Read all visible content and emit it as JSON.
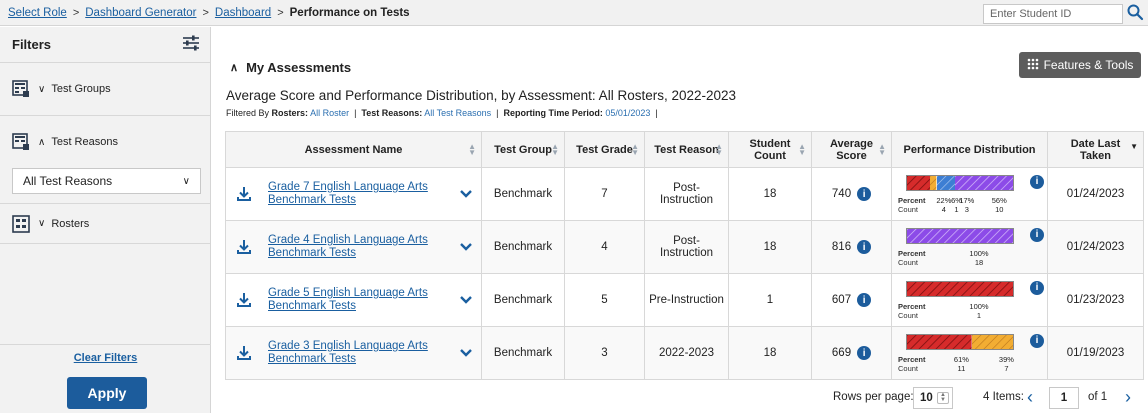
{
  "breadcrumb": {
    "items": [
      "Select Role",
      "Dashboard Generator",
      "Dashboard"
    ],
    "current": "Performance on Tests"
  },
  "student_search": {
    "placeholder": "Enter Student ID",
    "icon": "search-icon"
  },
  "sidebar": {
    "title": "Filters",
    "sections": [
      {
        "label": "Test Groups",
        "expanded": false,
        "icon": "test-groups-icon"
      },
      {
        "label": "Test Reasons",
        "expanded": true,
        "icon": "test-reasons-icon",
        "selected": "All Test Reasons"
      },
      {
        "label": "Rosters",
        "expanded": false,
        "icon": "rosters-icon"
      }
    ],
    "clear_filters": "Clear Filters",
    "apply": "Apply"
  },
  "main": {
    "section_title": "My Assessments",
    "features_button": "Features & Tools",
    "report_title": "Average Score and Performance Distribution, by Assessment: All Rosters, 2022-2023",
    "filtered_by": {
      "prefix": "Filtered By",
      "rosters_label": "Rosters:",
      "rosters_value": "All Roster",
      "reasons_label": "Test Reasons:",
      "reasons_value": "All Test Reasons",
      "period_label": "Reporting Time Period:",
      "period_value": "05/01/2023"
    },
    "columns": [
      "Assessment Name",
      "Test Group",
      "Test Grade",
      "Test Reason",
      "Student Count",
      "Average Score",
      "Performance Distribution",
      "Date Last Taken"
    ],
    "rows": [
      {
        "name": "Grade 7 English Language Arts Benchmark Tests",
        "group": "Benchmark",
        "grade": "7",
        "reason": "Post-Instruction",
        "count": "18",
        "avg": "740",
        "date": "01/24/2023",
        "dist": [
          {
            "pct": "22%",
            "cnt": "4",
            "value": 22,
            "color": "#d62b2b",
            "pattern": "red"
          },
          {
            "pct": "6%",
            "cnt": "1",
            "value": 6,
            "color": "#f0a830",
            "pattern": "orange"
          },
          {
            "pct": "17%",
            "cnt": "3",
            "value": 17,
            "color": "#3d7ed3",
            "pattern": "blue"
          },
          {
            "pct": "56%",
            "cnt": "10",
            "value": 55,
            "color": "#8c4be8",
            "pattern": "purple"
          }
        ]
      },
      {
        "name": "Grade 4 English Language Arts Benchmark Tests",
        "group": "Benchmark",
        "grade": "4",
        "reason": "Post-Instruction",
        "count": "18",
        "avg": "816",
        "date": "01/24/2023",
        "dist": [
          {
            "pct": "100%",
            "cnt": "18",
            "value": 100,
            "color": "#8c4be8",
            "pattern": "purple"
          }
        ]
      },
      {
        "name": "Grade 5 English Language Arts Benchmark Tests",
        "group": "Benchmark",
        "grade": "5",
        "reason": "Pre-Instruction",
        "count": "1",
        "avg": "607",
        "date": "01/23/2023",
        "dist": [
          {
            "pct": "100%",
            "cnt": "1",
            "value": 100,
            "color": "#d62b2b",
            "pattern": "red"
          }
        ]
      },
      {
        "name": "Grade 3 English Language Arts Benchmark Tests",
        "group": "Benchmark",
        "grade": "3",
        "reason": "2022-2023",
        "count": "18",
        "avg": "669",
        "date": "01/19/2023",
        "dist": [
          {
            "pct": "61%",
            "cnt": "11",
            "value": 61,
            "color": "#d62b2b",
            "pattern": "red"
          },
          {
            "pct": "39%",
            "cnt": "7",
            "value": 39,
            "color": "#f0a830",
            "pattern": "orange"
          }
        ]
      }
    ],
    "dist_labels": {
      "percent": "Percent",
      "count": "Count"
    }
  },
  "pagination": {
    "rows_per_page_label": "Rows per page:",
    "rows_per_page": "10",
    "items": "4 Items:",
    "page": "1",
    "of": "of 1"
  }
}
